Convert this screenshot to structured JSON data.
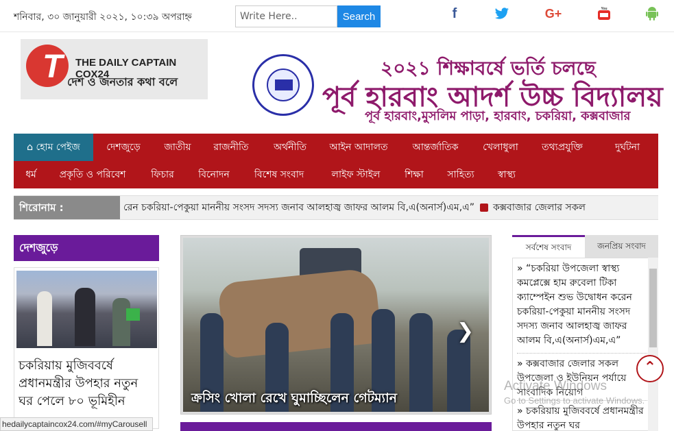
{
  "topbar": {
    "date": "শনিবার, ৩০ জানুয়ারী ২০২১, ১০:৩৯ অপরাহ্ন",
    "search_placeholder": "Write Here..",
    "search_label": "Search",
    "social": [
      {
        "icon": "facebook-icon",
        "glyph": "f",
        "color": "#3b5998"
      },
      {
        "icon": "twitter-icon",
        "glyph": "",
        "color": "#1da1f2"
      },
      {
        "icon": "google-plus-icon",
        "glyph": "G+",
        "color": "#dd4b39"
      },
      {
        "icon": "youtube-icon",
        "glyph": "",
        "color": "#e52d27"
      },
      {
        "icon": "android-icon",
        "glyph": "",
        "color": "#78c257"
      }
    ]
  },
  "header": {
    "logo_name": "THE DAILY CAPTAIN COX24",
    "logo_tagline": "দেশ ও জনতার কথা বলে",
    "logo_letter": "T",
    "ad_line1": "২০২১ শিক্ষাবর্ষে ভর্তি চলছে",
    "ad_line2": "পূর্ব হারবাং আদর্শ উচ্চ বিদ্যালয়",
    "ad_line3": "পূর্ব হারবাং,মুসলিম পাড়া, হারবাং, চকরিয়া, কক্সবাজার"
  },
  "nav": {
    "row1": [
      "হোম পেইজ",
      "দেশজুড়ে",
      "জাতীয়",
      "রাজনীতি",
      "অর্থনীতি",
      "আইন আদালত",
      "আন্তর্জাতিক",
      "খেলাধুলা",
      "তথ্যপ্রযুক্তি",
      "দুর্ঘটনা"
    ],
    "row2": [
      "ধর্ম",
      "প্রকৃতি ও পরিবেশ",
      "ফিচার",
      "বিনোদন",
      "বিশেষ সংবাদ",
      "লাইফ স্টাইল",
      "শিক্ষা",
      "সাহিত্য",
      "স্বাস্থ্য"
    ]
  },
  "ticker": {
    "label": "শিরোনাম :",
    "text_a": "রেন চকরিয়া-পেকুয়া মাননীয় সংসদ সদস্য জনাব আলহাজ্ব জাফর আলম বি,এ(অনার্স)এম,এ”",
    "text_b": "কক্সবাজার জেলার সকল"
  },
  "left": {
    "heading": "দেশজুড়ে",
    "card_title": "চকরিয়ায় মুজিববর্ষে প্রধানমন্ত্রীর উপহার নতুন ঘর পেলে ৮০ ভূমিহীন"
  },
  "slider": {
    "caption": "ক্রসিং খোলা রেখে ঘুমাচ্ছিলেন গেটম্যান"
  },
  "right": {
    "tab_latest": "সর্বশেষ সংবাদ",
    "tab_popular": "জনপ্রিয় সংবাদ",
    "items": [
      "» “চকরিয়া উপজেলা স্বাস্থ্য কমপ্লেক্সে হাম রুবেলা টিকা ক্যাম্পেইন শুভ উদ্বোধন করেন চকরিয়া-পেকুয়া মাননীয় সংসদ সদস্য জনাব আলহাজ্ব জাফর আলম বি,এ(অনার্স)এম,এ”",
      "» কক্সবাজার জেলার সকল উপজেলা ও ইউনিয়ন পর্যায়ে সাংবাদিক নিয়োগ",
      "» চকরিয়ায় মুজিববর্ষে প্রধানমন্ত্রীর উপহার নতুন ঘর"
    ]
  },
  "overlay": {
    "activate_line1": "Activate Windows",
    "activate_line2": "Go to Settings to activate Windows.",
    "status_url": "hedailycaptaincox24.com/#myCarousell"
  },
  "colors": {
    "nav_red": "#b1151a",
    "nav_active": "#1f6f8b",
    "purple": "#6a1b9a",
    "ad_text": "#8e1a6b",
    "search_blue": "#1e88e5"
  }
}
